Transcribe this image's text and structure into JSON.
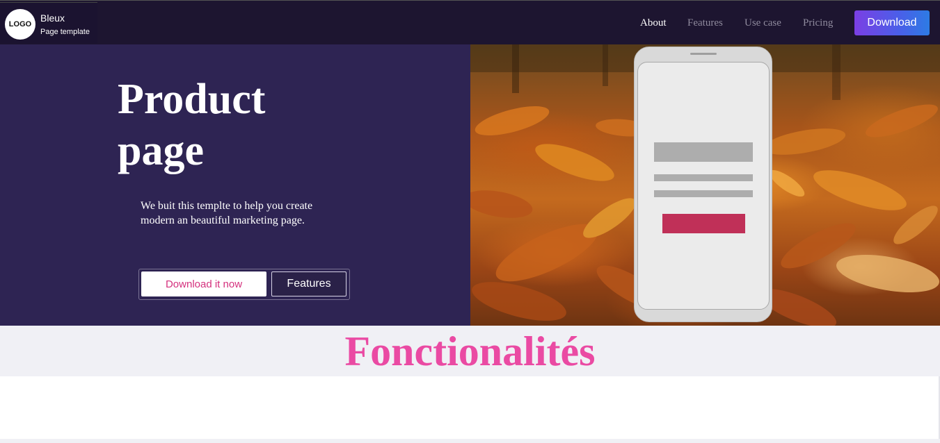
{
  "brand": {
    "logo_text": "LOGO",
    "name": "Bleux",
    "subtitle": "Page template"
  },
  "nav": {
    "items": [
      {
        "label": "About",
        "active": true
      },
      {
        "label": "Features",
        "active": false
      },
      {
        "label": "Use case",
        "active": false
      },
      {
        "label": "Pricing",
        "active": false
      }
    ],
    "download_label": "Download"
  },
  "hero": {
    "title": "Product page",
    "description": "We buit this templte to help you create modern an beautiful marketing page.",
    "primary_cta": "Download it now",
    "secondary_cta": "Features"
  },
  "features": {
    "title": "Fonctionalités"
  },
  "colors": {
    "nav_bg": "#1d1530",
    "hero_bg": "#2e2453",
    "accent_pink": "#ea4aa3",
    "cta_text": "#d4307d",
    "download_gradient_start": "#7b3fe4",
    "download_gradient_end": "#2d7be4",
    "phone_cta": "#c03058"
  }
}
